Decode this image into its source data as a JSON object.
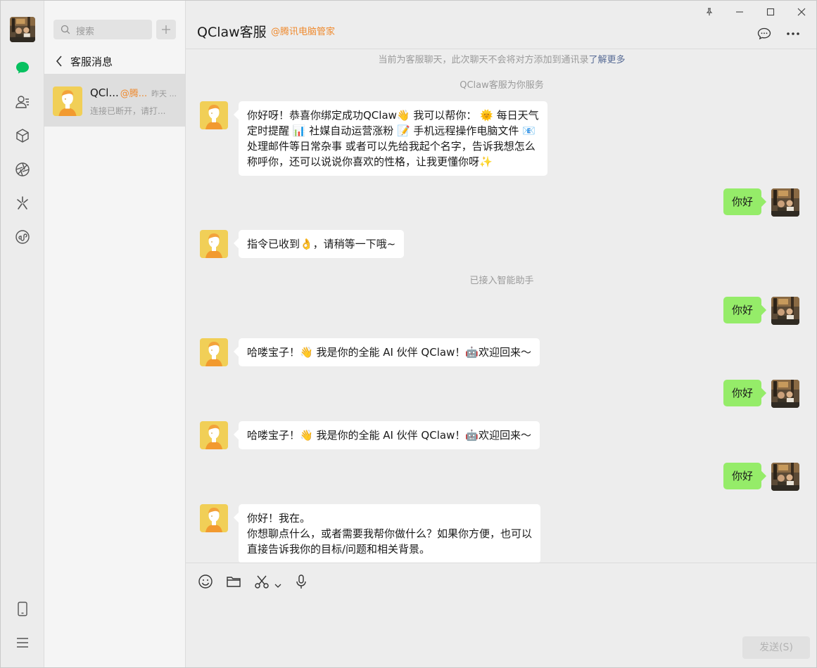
{
  "nav": {
    "icons": [
      "user-avatar",
      "chat-icon",
      "contacts-icon",
      "favorites-icon",
      "moments-icon",
      "channels-icon",
      "mini-programs-icon",
      "phone-icon",
      "menu-icon"
    ],
    "accent": "#07c160"
  },
  "list": {
    "search_placeholder": "搜索",
    "back_label": "客服消息",
    "session": {
      "name": "QCl...",
      "tag": "@腾...",
      "time": "昨天 ...",
      "preview": "连接已断开，请打..."
    }
  },
  "header": {
    "title": "QClaw客服",
    "tag": "@腾讯电脑管家",
    "tag_color": "#ef8a2e"
  },
  "notice": {
    "text": "当前为客服聊天，此次聊天不会将对方添加到通讯录",
    "link": "了解更多"
  },
  "messages": {
    "service_text": "QClaw客服为你服务",
    "m1": {
      "l1": "你好呀！恭喜你绑定成功QClaw👋 我可以帮你： 🌞 每日天气",
      "l2": "定时提醒 📊 社媒自动运营涨粉 📝 手机远程操作电脑文件 📧",
      "l3": "处理邮件等日常杂事 或者可以先给我起个名字，告诉我想怎么",
      "l4": "称呼你，还可以说说你喜欢的性格，让我更懂你呀✨"
    },
    "m2": "你好",
    "m3": "指令已收到👌，请稍等一下哦~",
    "sys2": "已接入智能助手",
    "m4": "你好",
    "m5": "哈喽宝子！👋 我是你的全能 AI 伙伴 QClaw！🤖欢迎回来～",
    "m6": "你好",
    "m7": "哈喽宝子！👋 我是你的全能 AI 伙伴 QClaw！🤖欢迎回来～",
    "m8": "你好",
    "m9": {
      "l1": "你好！我在。",
      "l2": "你想聊点什么，或者需要我帮你做什么？如果你方便，也可以",
      "l3": "直接告诉我你的目标/问题和相关背景。"
    }
  },
  "composer": {
    "send_label": "发送(S)",
    "tools": [
      "emoji-icon",
      "folder-icon",
      "scissors-icon",
      "chevron-down-icon",
      "microphone-icon"
    ]
  },
  "colors": {
    "my_bubble": "#95ec69",
    "their_bubble": "#ffffff",
    "chat_bg": "#ededed",
    "link": "#576b95"
  }
}
